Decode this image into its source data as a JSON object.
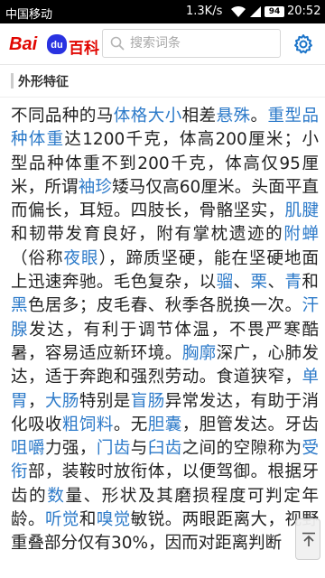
{
  "status_bar": {
    "carrier": "中国移动",
    "net_speed": "1.3K/s",
    "battery": "94",
    "time": "20:52"
  },
  "header": {
    "logo_bai": "Bai",
    "logo_du": "du",
    "logo_baike": "百科",
    "search_placeholder": "搜索词条"
  },
  "section": {
    "title": "外形特征"
  },
  "article": {
    "segments": [
      {
        "text": "不同品种的马",
        "link": false
      },
      {
        "text": "体格大小",
        "link": true
      },
      {
        "text": "相差",
        "link": false
      },
      {
        "text": "悬殊",
        "link": true
      },
      {
        "text": "。",
        "link": false
      },
      {
        "text": "重型品种体重",
        "link": true
      },
      {
        "text": "达1200千克，体高200厘米；小型品种体重不到200千克，体高仅95厘米，所谓",
        "link": false
      },
      {
        "text": "袖珍",
        "link": true
      },
      {
        "text": "矮马仅高60厘米。头面平直而偏长，耳短。四肢长，骨骼坚实，",
        "link": false
      },
      {
        "text": "肌腱",
        "link": true
      },
      {
        "text": "和韧带发育良好，附有掌枕遗迹的",
        "link": false
      },
      {
        "text": "附蝉",
        "link": true
      },
      {
        "text": "（俗称",
        "link": false
      },
      {
        "text": "夜眼",
        "link": true
      },
      {
        "text": "），蹄质坚硬，能在坚硬地面上迅速奔驰。毛色复杂，以",
        "link": false
      },
      {
        "text": "骝",
        "link": true
      },
      {
        "text": "、",
        "link": false
      },
      {
        "text": "栗",
        "link": true
      },
      {
        "text": "、",
        "link": false
      },
      {
        "text": "青",
        "link": true
      },
      {
        "text": "和",
        "link": false
      },
      {
        "text": "黑",
        "link": true
      },
      {
        "text": "色居多；皮毛春、秋季各脱换一次。",
        "link": false
      },
      {
        "text": "汗腺",
        "link": true
      },
      {
        "text": "发达，有利于调节体温，不畏严寒酷暑，容易适应新环境。",
        "link": false
      },
      {
        "text": "胸廓",
        "link": true
      },
      {
        "text": "深广，心肺发达，适于奔跑和强烈劳动。食道狭窄，",
        "link": false
      },
      {
        "text": "单胃",
        "link": true
      },
      {
        "text": "，",
        "link": false
      },
      {
        "text": "大肠",
        "link": true
      },
      {
        "text": "特别是",
        "link": false
      },
      {
        "text": "盲肠",
        "link": true
      },
      {
        "text": "异常发达，有助于消化吸收",
        "link": false
      },
      {
        "text": "粗饲料",
        "link": true
      },
      {
        "text": "。无",
        "link": false
      },
      {
        "text": "胆囊",
        "link": true
      },
      {
        "text": "，胆管发达。牙齿",
        "link": false
      },
      {
        "text": "咀嚼",
        "link": true
      },
      {
        "text": "力强，",
        "link": false
      },
      {
        "text": "门齿",
        "link": true
      },
      {
        "text": "与",
        "link": false
      },
      {
        "text": "臼齿",
        "link": true
      },
      {
        "text": "之间的空隙称为",
        "link": false
      },
      {
        "text": "受衔",
        "link": true
      },
      {
        "text": "部，装鞍时放衔体，以便驾御。根据牙齿的",
        "link": false
      },
      {
        "text": "数",
        "link": true
      },
      {
        "text": "量、形状及其磨损程度可判定年龄。",
        "link": false
      },
      {
        "text": "听觉",
        "link": true
      },
      {
        "text": "和",
        "link": false
      },
      {
        "text": "嗅觉",
        "link": true
      },
      {
        "text": "敏锐。两眼距离大，视野重叠部分仅有30%，因而对距离判断",
        "link": false
      }
    ]
  },
  "colors": {
    "link": "#2c7ac9",
    "brand_red": "#e10601",
    "brand_blue": "#2932e1",
    "settings_icon": "#1a73c9"
  },
  "icons": {
    "search": "search-icon",
    "settings": "gear-icon",
    "back_to_top": "arrow-up-icon"
  }
}
